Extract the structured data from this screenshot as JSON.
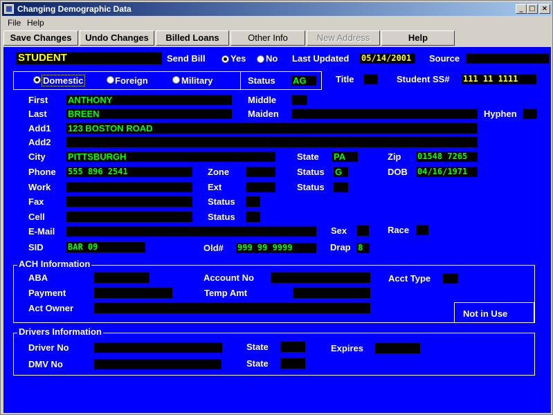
{
  "window": {
    "title": "Changing Demographic Data",
    "minimize_glyph": "_",
    "maximize_glyph": "□",
    "close_glyph": "×"
  },
  "menu": {
    "file": "File",
    "help": "Help"
  },
  "toolbar": {
    "save": "Save Changes",
    "undo": "Undo Changes",
    "billed": "Billed Loans",
    "other": "Other Info",
    "new_address": "New Address",
    "help": "Help"
  },
  "header": {
    "student": "STUDENT",
    "send_bill": "Send Bill",
    "yes": "Yes",
    "no": "No",
    "last_updated_label": "Last Updated",
    "last_updated": "05/14/2001",
    "source_label": "Source",
    "source": ""
  },
  "address_type": {
    "domestic": "Domestic",
    "foreign": "Foreign",
    "military": "Military",
    "status_label": "Status",
    "status": "AG",
    "title_label": "Title",
    "title": "",
    "ssn_label": "Student SS#",
    "ssn": "111 11 1111"
  },
  "fields": {
    "first_label": "First",
    "first": "ANTHONY",
    "middle_label": "Middle",
    "middle": "",
    "last_label": "Last",
    "last": "BREEN",
    "maiden_label": "Maiden",
    "maiden": "",
    "hyphen_label": "Hyphen",
    "hyphen": "",
    "add1_label": "Add1",
    "add1": "123 BOSTON ROAD",
    "add2_label": "Add2",
    "add2": "",
    "city_label": "City",
    "city": "PITTSBURGH",
    "state_label": "State",
    "state": "PA",
    "zip_label": "Zip",
    "zip": "01548 7265",
    "phone_label": "Phone",
    "phone": "555 896 2541",
    "zone_label": "Zone",
    "zone": "",
    "phone_status_label": "Status",
    "phone_status": "G",
    "dob_label": "DOB",
    "dob": "04/16/1971",
    "work_label": "Work",
    "work": "",
    "ext_label": "Ext",
    "ext": "",
    "work_status_label": "Status",
    "work_status": "",
    "fax_label": "Fax",
    "fax": "",
    "fax_status_label": "Status",
    "fax_status": "",
    "cell_label": "Cell",
    "cell": "",
    "cell_status_label": "Status",
    "cell_status": "",
    "email_label": "E-Mail",
    "email": "",
    "sex_label": "Sex",
    "sex": "",
    "race_label": "Race",
    "race": "",
    "sid_label": "SID",
    "sid": "BAR 09",
    "old_label": "Old#",
    "old": "999 99 9999",
    "drap_label": "Drap",
    "drap": "8"
  },
  "ach": {
    "title": "ACH Information",
    "aba_label": "ABA",
    "aba": "",
    "account_label": "Account No",
    "account": "",
    "acct_type_label": "Acct Type",
    "acct_type": "",
    "payment_label": "Payment",
    "payment": "",
    "temp_amt_label": "Temp Amt",
    "temp_amt": "",
    "owner_label": "Act Owner",
    "owner": "",
    "not_in_use": "Not in Use"
  },
  "drivers": {
    "title": "Drivers Information",
    "driver_no_label": "Driver No",
    "driver_no": "",
    "state1_label": "State",
    "state1": "",
    "expires_label": "Expires",
    "expires": "",
    "dmv_label": "DMV No",
    "dmv": "",
    "state2_label": "State",
    "state2": ""
  }
}
